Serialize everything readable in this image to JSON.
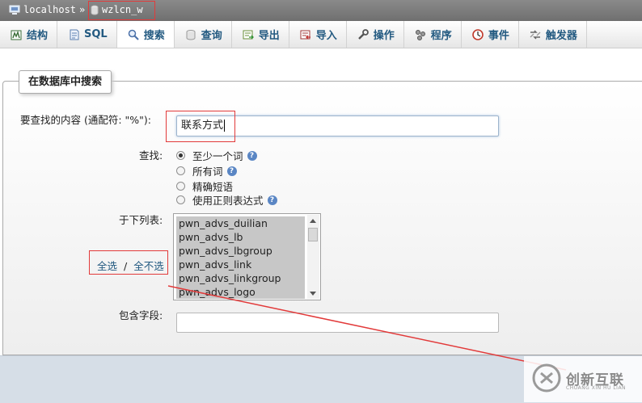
{
  "breadcrumb": {
    "server": "localhost",
    "separator": "»",
    "database": "wzlcn_w"
  },
  "tabs": [
    {
      "label": "结构",
      "icon": "structure-icon"
    },
    {
      "label": "SQL",
      "icon": "sql-icon"
    },
    {
      "label": "搜索",
      "icon": "search-icon",
      "active": true
    },
    {
      "label": "查询",
      "icon": "query-icon"
    },
    {
      "label": "导出",
      "icon": "export-icon"
    },
    {
      "label": "导入",
      "icon": "import-icon"
    },
    {
      "label": "操作",
      "icon": "wrench-icon"
    },
    {
      "label": "程序",
      "icon": "routines-icon"
    },
    {
      "label": "事件",
      "icon": "clock-icon"
    },
    {
      "label": "触发器",
      "icon": "triggers-icon"
    }
  ],
  "search": {
    "legend": "在数据库中搜索",
    "find_label": "要查找的内容 (通配符: \"%\"):",
    "find_value": "联系方式",
    "mode_label": "查找:",
    "modes": [
      {
        "label": "至少一个词",
        "selected": true,
        "help": true
      },
      {
        "label": "所有词",
        "selected": false,
        "help": true
      },
      {
        "label": "精确短语",
        "selected": false,
        "help": false
      },
      {
        "label": "使用正则表达式",
        "selected": false,
        "help": true
      }
    ],
    "tables_label": "于下列表:",
    "tables": [
      "pwn_advs_duilian",
      "pwn_advs_lb",
      "pwn_advs_lbgroup",
      "pwn_advs_link",
      "pwn_advs_linkgroup",
      "pwn_advs_logo"
    ],
    "select_all": "全选",
    "select_sep": "/",
    "select_none": "全不选",
    "field_label": "包含字段:",
    "field_value": ""
  },
  "watermark": {
    "brand": "创新互联",
    "sub": "CHUANG XIN HU LIAN"
  },
  "colors": {
    "annotation": "#e23a3a",
    "link": "#235a81"
  }
}
